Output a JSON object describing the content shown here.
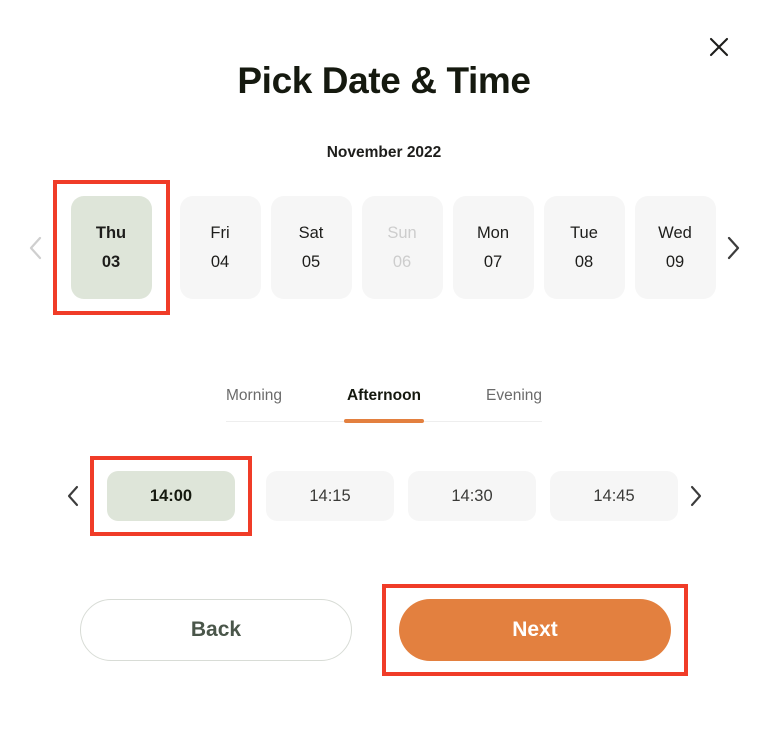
{
  "dialog": {
    "title": "Pick Date & Time",
    "close_icon": "close-icon",
    "month_label": "November 2022"
  },
  "date_picker": {
    "prev_icon": "chevron-left-icon",
    "next_icon": "chevron-right-icon",
    "days": [
      {
        "dow": "Thu",
        "day": "03",
        "state": "selected"
      },
      {
        "dow": "Fri",
        "day": "04",
        "state": "default"
      },
      {
        "dow": "Sat",
        "day": "05",
        "state": "default"
      },
      {
        "dow": "Sun",
        "day": "06",
        "state": "disabled"
      },
      {
        "dow": "Mon",
        "day": "07",
        "state": "default"
      },
      {
        "dow": "Tue",
        "day": "08",
        "state": "default"
      },
      {
        "dow": "Wed",
        "day": "09",
        "state": "default"
      }
    ]
  },
  "period_tabs": {
    "items": [
      {
        "label": "Morning",
        "active": false
      },
      {
        "label": "Afternoon",
        "active": true
      },
      {
        "label": "Evening",
        "active": false
      }
    ]
  },
  "time_picker": {
    "prev_icon": "chevron-left-icon",
    "next_icon": "chevron-right-icon",
    "slots": [
      {
        "time": "14:00",
        "state": "selected"
      },
      {
        "time": "14:15",
        "state": "default"
      },
      {
        "time": "14:30",
        "state": "default"
      },
      {
        "time": "14:45",
        "state": "default"
      }
    ]
  },
  "footer": {
    "back_label": "Back",
    "next_label": "Next"
  },
  "colors": {
    "accent_orange": "#e3803f",
    "selected_green": "#dee5d9",
    "card_grey": "#f6f6f6",
    "annotation_red": "#f03c28",
    "text_dark": "#15190f",
    "text_muted": "#6b6b6b",
    "back_text": "#4a564a"
  }
}
